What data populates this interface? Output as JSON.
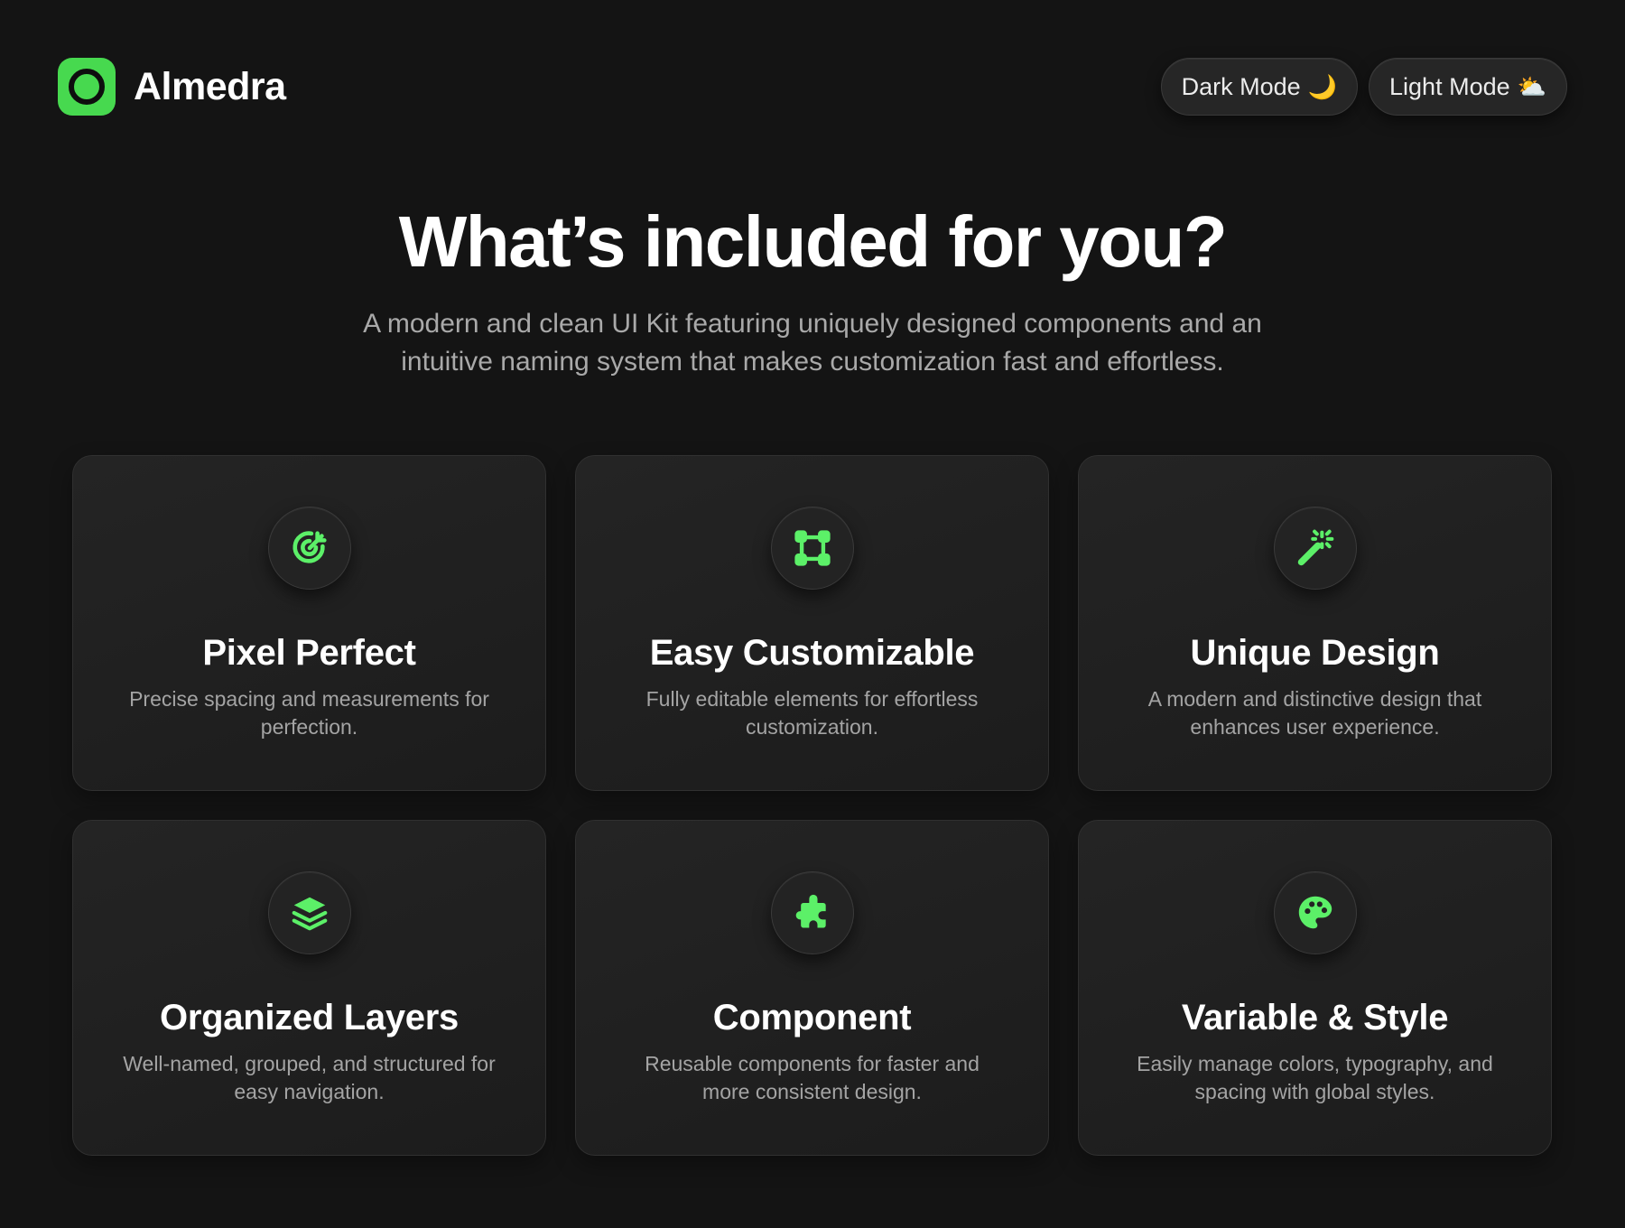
{
  "brand": {
    "name": "Almedra",
    "accent_color": "#47d94f",
    "logo_icon": "ring-logo-icon"
  },
  "mode_toggle": {
    "dark_label": "Dark Mode",
    "dark_icon": "🌙",
    "light_label": "Light Mode",
    "light_icon": "⛅"
  },
  "hero": {
    "title": "What’s included for you?",
    "subtitle": "A modern and clean UI Kit featuring uniquely designed components and an intuitive naming system that makes customization fast and effortless."
  },
  "features": [
    {
      "icon": "target-arrow-icon",
      "title": "Pixel Perfect",
      "description": "Precise spacing and measurements for perfection."
    },
    {
      "icon": "vector-square-icon",
      "title": "Easy Customizable",
      "description": "Fully editable elements for effortless customization."
    },
    {
      "icon": "magic-wand-icon",
      "title": "Unique Design",
      "description": "A modern and distinctive design that enhances user experience."
    },
    {
      "icon": "layers-icon",
      "title": "Organized Layers",
      "description": "Well-named, grouped, and structured for easy navigation."
    },
    {
      "icon": "puzzle-icon",
      "title": "Component",
      "description": "Reusable components for faster and more consistent design."
    },
    {
      "icon": "palette-icon",
      "title": "Variable & Style",
      "description": "Easily manage colors, typography, and spacing with global styles."
    }
  ]
}
